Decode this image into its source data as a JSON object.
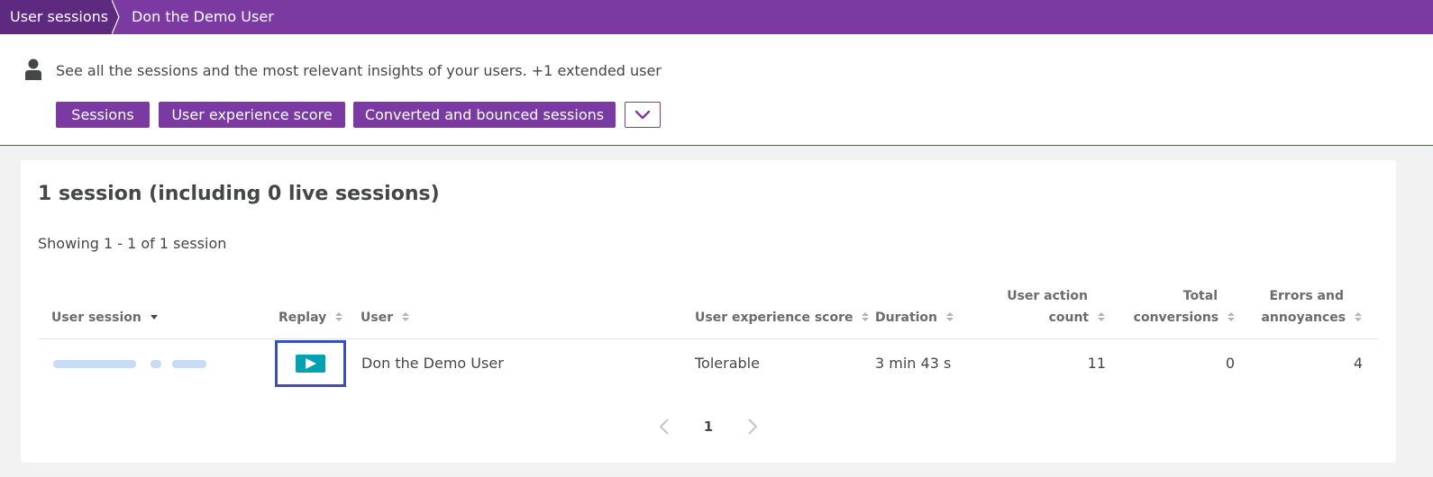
{
  "breadcrumb": {
    "root_label": "User sessions",
    "current_label": "Don the Demo User"
  },
  "header": {
    "description": "See all the sessions and the most relevant insights of your users. +1 extended user",
    "chips": [
      "Sessions",
      "User experience score",
      "Converted and bounced sessions"
    ],
    "more_icon": "chevron-down-icon"
  },
  "main": {
    "title": "1 session (including 0 live sessions)",
    "showing": "Showing 1 - 1 of 1 session",
    "columns": {
      "user_session": "User session",
      "replay": "Replay",
      "user": "User",
      "ux_score": "User experience score",
      "duration": "Duration",
      "user_action_count": [
        "User action",
        "count"
      ],
      "total_conversions": [
        "Total",
        "conversions"
      ],
      "errors_annoyances": [
        "Errors and",
        "annoyances"
      ]
    },
    "rows": [
      {
        "user": "Don the Demo User",
        "ux_score": "Tolerable",
        "duration": "3 min 43 s",
        "user_action_count": "11",
        "total_conversions": "0",
        "errors_annoyances": "4"
      }
    ],
    "pagination": {
      "current_page": "1"
    }
  },
  "colors": {
    "brand_purple": "#7b3aa1",
    "breadcrumb_dark": "#5d2a80",
    "replay_teal": "#00a1b2",
    "focus_blue": "#3c4dbf"
  }
}
